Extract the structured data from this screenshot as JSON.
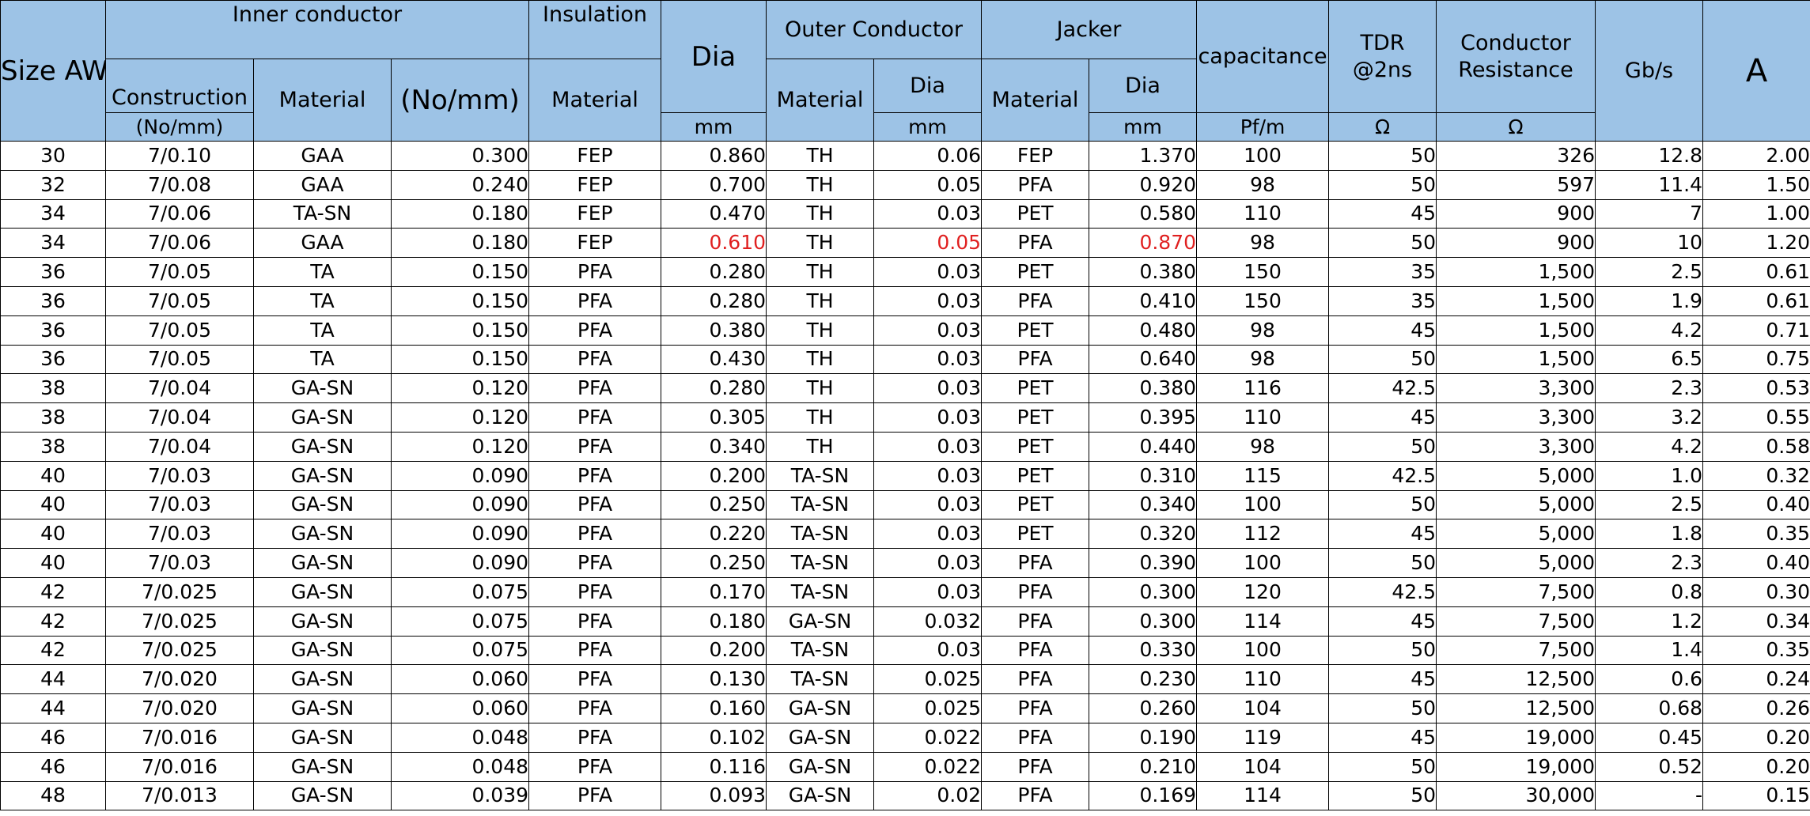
{
  "headers": {
    "size_awg": "Size AWG",
    "inner_conductor": "Inner conductor",
    "insulation": "Insulation",
    "dia": "Dia",
    "outer_conductor": "Outer Conductor",
    "jacker": "Jacker",
    "capacitance": "capacitance",
    "tdr": "TDR @2ns",
    "conductor_resistance": "Conductor Resistance",
    "gbps": "Gb/s",
    "amps": "A",
    "construction": "Construction",
    "construction_unit": "(No/mm)",
    "material": "Material",
    "no_mm": "(No/mm)",
    "ins_material": "Material",
    "oc_material": "Material",
    "oc_dia": "Dia",
    "jk_material": "Material",
    "jk_dia": "Dia",
    "unit_mm": "mm",
    "unit_pfm": "Pf/m",
    "unit_ohm": "Ω"
  },
  "highlight_color": "#e02020",
  "header_color": "#9dc3e6",
  "rows": [
    [
      "30",
      "7/0.10",
      "GAA",
      "0.300",
      "FEP",
      "0.860",
      "TH",
      "0.06",
      "FEP",
      "1.370",
      "100",
      "50",
      "326",
      "12.8",
      "2.00"
    ],
    [
      "32",
      "7/0.08",
      "GAA",
      "0.240",
      "FEP",
      "0.700",
      "TH",
      "0.05",
      "PFA",
      "0.920",
      "98",
      "50",
      "597",
      "11.4",
      "1.50"
    ],
    [
      "34",
      "7/0.06",
      "TA-SN",
      "0.180",
      "FEP",
      "0.470",
      "TH",
      "0.03",
      "PET",
      "0.580",
      "110",
      "45",
      "900",
      "7",
      "1.00"
    ],
    [
      "34",
      "7/0.06",
      "GAA",
      "0.180",
      "FEP",
      "0.610",
      "TH",
      "0.05",
      "PFA",
      "0.870",
      "98",
      "50",
      "900",
      "10",
      "1.20"
    ],
    [
      "36",
      "7/0.05",
      "TA",
      "0.150",
      "PFA",
      "0.280",
      "TH",
      "0.03",
      "PET",
      "0.380",
      "150",
      "35",
      "1,500",
      "2.5",
      "0.61"
    ],
    [
      "36",
      "7/0.05",
      "TA",
      "0.150",
      "PFA",
      "0.280",
      "TH",
      "0.03",
      "PFA",
      "0.410",
      "150",
      "35",
      "1,500",
      "1.9",
      "0.61"
    ],
    [
      "36",
      "7/0.05",
      "TA",
      "0.150",
      "PFA",
      "0.380",
      "TH",
      "0.03",
      "PET",
      "0.480",
      "98",
      "45",
      "1,500",
      "4.2",
      "0.71"
    ],
    [
      "36",
      "7/0.05",
      "TA",
      "0.150",
      "PFA",
      "0.430",
      "TH",
      "0.03",
      "PFA",
      "0.640",
      "98",
      "50",
      "1,500",
      "6.5",
      "0.75"
    ],
    [
      "38",
      "7/0.04",
      "GA-SN",
      "0.120",
      "PFA",
      "0.280",
      "TH",
      "0.03",
      "PET",
      "0.380",
      "116",
      "42.5",
      "3,300",
      "2.3",
      "0.53"
    ],
    [
      "38",
      "7/0.04",
      "GA-SN",
      "0.120",
      "PFA",
      "0.305",
      "TH",
      "0.03",
      "PET",
      "0.395",
      "110",
      "45",
      "3,300",
      "3.2",
      "0.55"
    ],
    [
      "38",
      "7/0.04",
      "GA-SN",
      "0.120",
      "PFA",
      "0.340",
      "TH",
      "0.03",
      "PET",
      "0.440",
      "98",
      "50",
      "3,300",
      "4.2",
      "0.58"
    ],
    [
      "40",
      "7/0.03",
      "GA-SN",
      "0.090",
      "PFA",
      "0.200",
      "TA-SN",
      "0.03",
      "PET",
      "0.310",
      "115",
      "42.5",
      "5,000",
      "1.0",
      "0.32"
    ],
    [
      "40",
      "7/0.03",
      "GA-SN",
      "0.090",
      "PFA",
      "0.250",
      "TA-SN",
      "0.03",
      "PET",
      "0.340",
      "100",
      "50",
      "5,000",
      "2.5",
      "0.40"
    ],
    [
      "40",
      "7/0.03",
      "GA-SN",
      "0.090",
      "PFA",
      "0.220",
      "TA-SN",
      "0.03",
      "PET",
      "0.320",
      "112",
      "45",
      "5,000",
      "1.8",
      "0.35"
    ],
    [
      "40",
      "7/0.03",
      "GA-SN",
      "0.090",
      "PFA",
      "0.250",
      "TA-SN",
      "0.03",
      "PFA",
      "0.390",
      "100",
      "50",
      "5,000",
      "2.3",
      "0.40"
    ],
    [
      "42",
      "7/0.025",
      "GA-SN",
      "0.075",
      "PFA",
      "0.170",
      "TA-SN",
      "0.03",
      "PFA",
      "0.300",
      "120",
      "42.5",
      "7,500",
      "0.8",
      "0.30"
    ],
    [
      "42",
      "7/0.025",
      "GA-SN",
      "0.075",
      "PFA",
      "0.180",
      "GA-SN",
      "0.032",
      "PFA",
      "0.300",
      "114",
      "45",
      "7,500",
      "1.2",
      "0.34"
    ],
    [
      "42",
      "7/0.025",
      "GA-SN",
      "0.075",
      "PFA",
      "0.200",
      "TA-SN",
      "0.03",
      "PFA",
      "0.330",
      "100",
      "50",
      "7,500",
      "1.4",
      "0.35"
    ],
    [
      "44",
      "7/0.020",
      "GA-SN",
      "0.060",
      "PFA",
      "0.130",
      "TA-SN",
      "0.025",
      "PFA",
      "0.230",
      "110",
      "45",
      "12,500",
      "0.6",
      "0.24"
    ],
    [
      "44",
      "7/0.020",
      "GA-SN",
      "0.060",
      "PFA",
      "0.160",
      "GA-SN",
      "0.025",
      "PFA",
      "0.260",
      "104",
      "50",
      "12,500",
      "0.68",
      "0.26"
    ],
    [
      "46",
      "7/0.016",
      "GA-SN",
      "0.048",
      "PFA",
      "0.102",
      "GA-SN",
      "0.022",
      "PFA",
      "0.190",
      "119",
      "45",
      "19,000",
      "0.45",
      "0.20"
    ],
    [
      "46",
      "7/0.016",
      "GA-SN",
      "0.048",
      "PFA",
      "0.116",
      "GA-SN",
      "0.022",
      "PFA",
      "0.210",
      "104",
      "50",
      "19,000",
      "0.52",
      "0.20"
    ],
    [
      "48",
      "7/0.013",
      "GA-SN",
      "0.039",
      "PFA",
      "0.093",
      "GA-SN",
      "0.02",
      "PFA",
      "0.169",
      "114",
      "50",
      "30,000",
      "-",
      "0.15"
    ]
  ]
}
